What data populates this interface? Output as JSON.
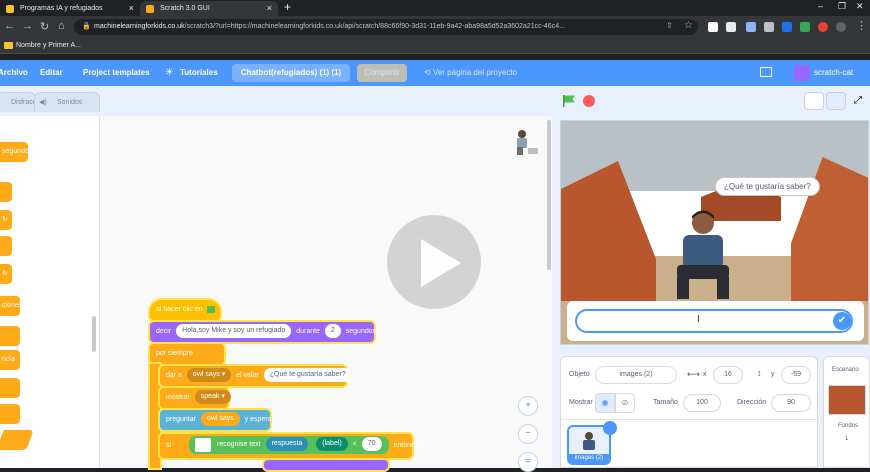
{
  "browser": {
    "tabs": [
      {
        "title": "Programas IA y refugiados",
        "close": "×"
      },
      {
        "title": "Scratch 3.0 GUI",
        "close": "×"
      }
    ],
    "new_tab": "+",
    "url_host": "machinelearningforkids.co.uk",
    "url_path": "/scratch3/?url=https://machinelearningforkids.co.uk/api/scratch/88c66f90-3d31-11eb-9a42-aba98a5d52a3602a21cc-46c4...",
    "bookmark": "Nombre y Primer A..."
  },
  "menu": {
    "file": "Archivo",
    "edit": "Editar",
    "templates": "Project templates",
    "tutorials": "Tutoriales",
    "project_title": "Chatbot(refugiados) (1) (1)",
    "share": "Compartir",
    "see_project": "Ver página del proyecto",
    "account": "scratch-cat"
  },
  "editor": {
    "tab_costumes": "Disfraces",
    "tab_sounds": "Sonidos",
    "palette": [
      "segundos",
      "",
      "",
      "",
      "",
      "ciones",
      "",
      "ncia",
      "",
      ""
    ],
    "blocks": {
      "hat": "al hacer clic en",
      "say_label": "decir",
      "say_text": "Hola,soy Mike y soy un refugiado",
      "say_during": "durante",
      "say_secs": "2",
      "say_unit": "segundos",
      "forever": "por siempre",
      "set_label": "dar a",
      "set_var": "owl says",
      "set_value_label": "el valor",
      "set_value": "¿Qué te gustaría saber?",
      "show_label": "mostrar",
      "show_var": "speak",
      "ask_label": "preguntar",
      "ask_var": "owl says",
      "ask_wait": "y esperar",
      "if_label": "si",
      "ml_label": "recognise text",
      "ml_answer": "respuesta",
      "ml_field": "(label)",
      "op_lt": "<",
      "op_value": "70",
      "then": "entonces"
    },
    "zoom_in": "+",
    "zoom_out": "−",
    "zoom_reset": "="
  },
  "stage": {
    "speech": "¿Qué te gustaría saber?",
    "answer_value": "",
    "answer_ok": "✔"
  },
  "sprite": {
    "label_sprite": "Objeto",
    "name": "images (2)",
    "label_x": "x",
    "x": "16",
    "label_y": "y",
    "y": "-59",
    "label_show": "Mostrar",
    "label_size": "Tamaño",
    "size": "100",
    "label_direction": "Dirección",
    "direction": "90",
    "thumb_label": "images (2)"
  },
  "stage_panel": {
    "title": "Escenario",
    "backdrops_label": "Fondos",
    "backdrops_count": "1"
  },
  "colors": {
    "scratch_blue": "#4c97ff",
    "events": "#ffbf00",
    "looks": "#9966ff",
    "control": "#ffab19",
    "sensing": "#5cb1d6",
    "operators": "#59c059",
    "stop_red": "#ff5b5b"
  }
}
